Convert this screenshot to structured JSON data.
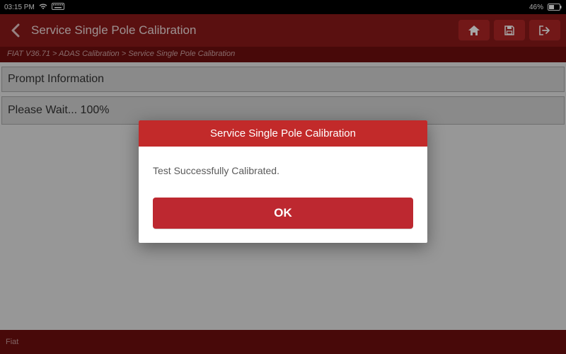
{
  "status": {
    "time": "03:15 PM",
    "battery_pct": "46%"
  },
  "header": {
    "title": "Service Single Pole Calibration"
  },
  "breadcrumb": {
    "text": "FIAT V36.71 > ADAS Calibration > Service Single Pole Calibration"
  },
  "panels": {
    "prompt_label": "Prompt Information",
    "wait_label": "Please Wait... 100%"
  },
  "footer": {
    "text": "Fiat"
  },
  "modal": {
    "title": "Service Single Pole Calibration",
    "message": "Test Successfully Calibrated.",
    "ok_label": "OK"
  },
  "colors": {
    "header_bg": "#8a1a1a",
    "accent": "#c22a2a",
    "button": "#bd2830"
  }
}
